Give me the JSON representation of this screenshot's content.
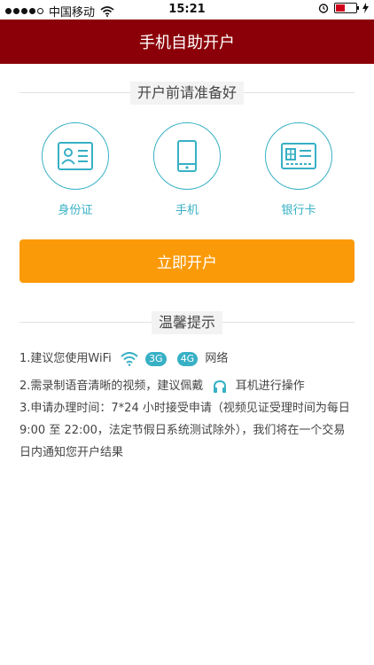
{
  "status_bar": {
    "carrier": "中国移动",
    "time": "15:21"
  },
  "header": {
    "title": "手机自助开户"
  },
  "prepare": {
    "heading": "开户前请准备好",
    "items": [
      {
        "label": "身份证",
        "icon": "id-card-icon"
      },
      {
        "label": "手机",
        "icon": "phone-icon"
      },
      {
        "label": "银行卡",
        "icon": "bank-card-icon"
      }
    ]
  },
  "action": {
    "open_account_label": "立即开户"
  },
  "tips": {
    "heading": "温馨提示",
    "line1_prefix": "1.建议您使用WiFi",
    "badge_3g": "3G",
    "badge_4g": "4G",
    "line1_suffix": "网络",
    "line2_prefix": "2.需录制语音清晰的视频，建议佩戴",
    "line2_suffix": "耳机进行操作",
    "line3": "3.申请办理时间：7*24 小时接受申请（视频见证受理时间为每日 9:00 至 22:00，法定节假日系统测试除外），我们将在一个交易日内通知您开户结果"
  },
  "colors": {
    "header_bg": "#8b0008",
    "accent": "#37b0c5",
    "button": "#fb9a08"
  }
}
